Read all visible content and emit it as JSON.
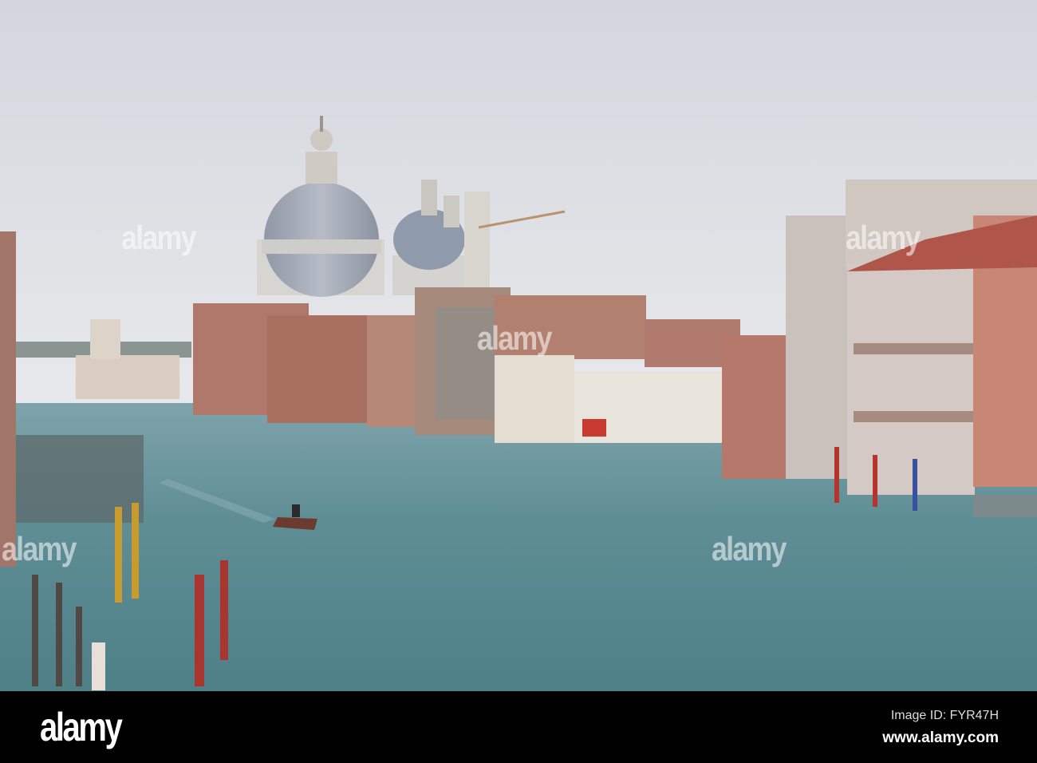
{
  "watermark": {
    "text": "alamy"
  },
  "footer": {
    "logo": "alamy",
    "image_id": "Image ID: FYR47H",
    "url": "www.alamy.com"
  },
  "colors": {
    "sky": "#dfe1e6",
    "water": "#5f8e95",
    "brick": "#b07a6c",
    "footer": "#000000"
  }
}
